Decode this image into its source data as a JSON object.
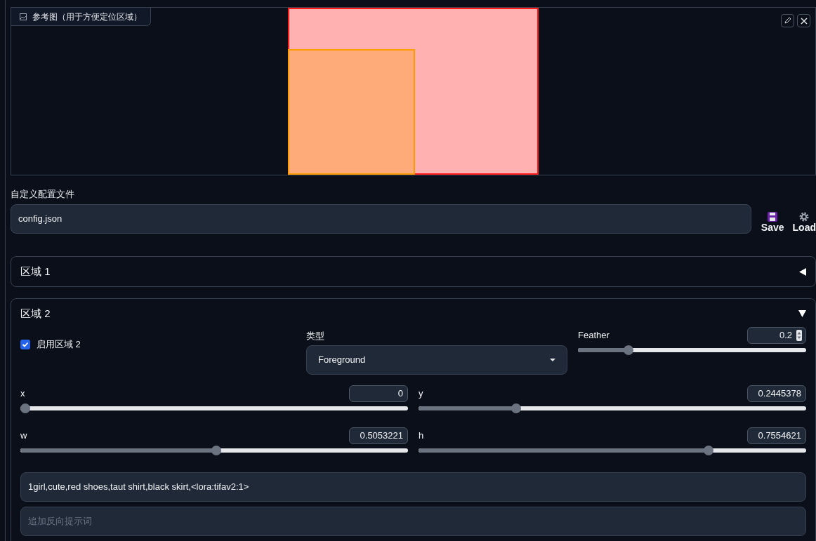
{
  "reference": {
    "label": "参考图（用于方便定位区域）"
  },
  "config": {
    "label": "自定义配置文件",
    "value": "config.json",
    "buttons": [
      {
        "kind": "save",
        "label": "Save"
      },
      {
        "kind": "load",
        "label": "Load"
      }
    ]
  },
  "regions": [
    {
      "title": "区域 1",
      "expanded": false
    },
    {
      "title": "区域 2",
      "expanded": true,
      "enable": {
        "label": "启用区域 2",
        "checked": true
      },
      "type": {
        "label": "类型",
        "value": "Foreground"
      },
      "feather": {
        "label": "Feather",
        "value": "0.2",
        "level": 0.21
      },
      "sliders": [
        {
          "label": "x",
          "value": "0",
          "level": 0
        },
        {
          "label": "y",
          "value": "0.2445378",
          "level": 0.245
        },
        {
          "label": "w",
          "value": "0.5053221",
          "level": 0.505
        },
        {
          "label": "h",
          "value": "0.7554621",
          "level": 0.755
        }
      ],
      "prompt": "1girl,cute,red shoes,taut shirt,black skirt,<lora:tifav2:1>",
      "negative_placeholder": "追加反向提示词"
    }
  ]
}
